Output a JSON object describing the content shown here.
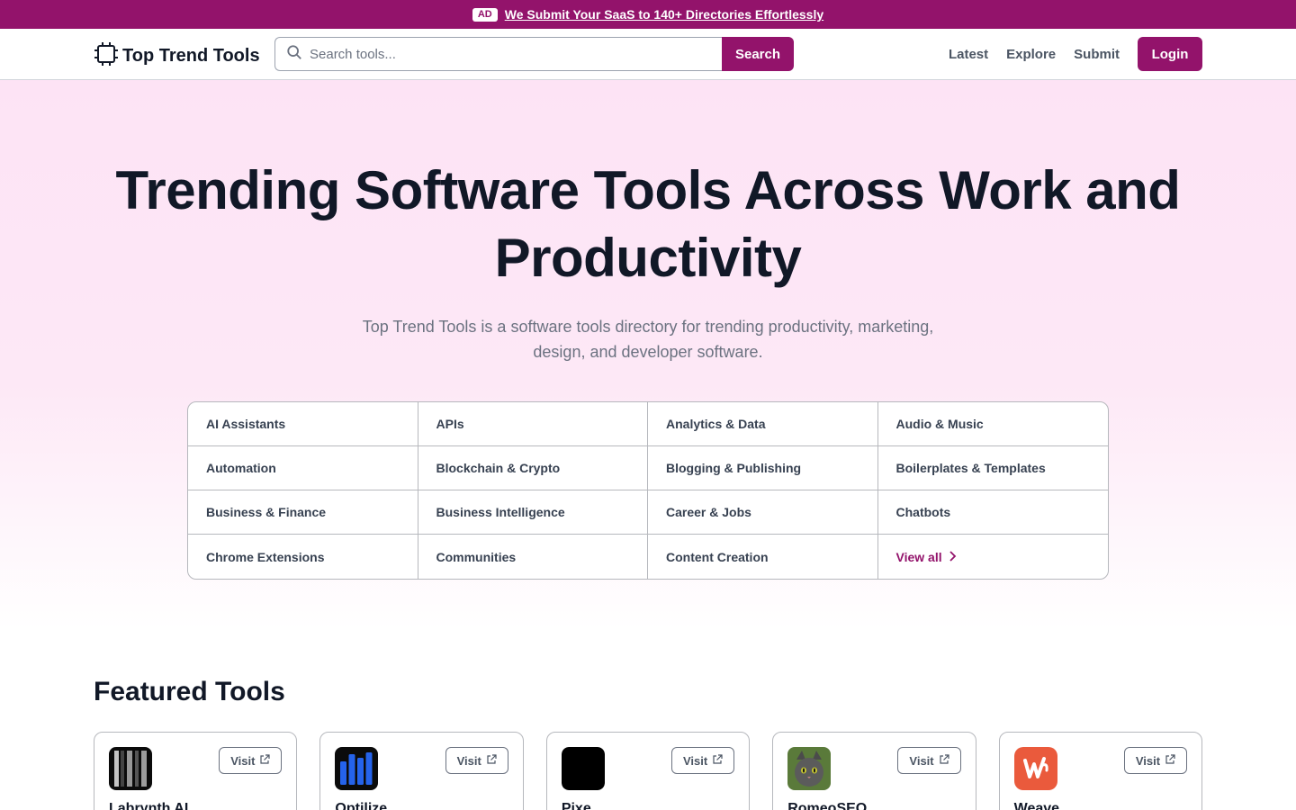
{
  "ad": {
    "badge": "AD",
    "text": "We Submit Your SaaS to 140+ Directories Effortlessly"
  },
  "header": {
    "logo_text": "Top Trend Tools",
    "search_placeholder": "Search tools...",
    "search_button": "Search",
    "nav": [
      "Latest",
      "Explore",
      "Submit"
    ],
    "login": "Login"
  },
  "hero": {
    "title": "Trending Software Tools Across Work and Productivity",
    "subtitle": "Top Trend Tools is a software tools directory for trending productivity, marketing, design, and developer software."
  },
  "categories": [
    "AI Assistants",
    "APIs",
    "Analytics & Data",
    "Audio & Music",
    "Automation",
    "Blockchain & Crypto",
    "Blogging & Publishing",
    "Boilerplates & Templates",
    "Business & Finance",
    "Business Intelligence",
    "Career & Jobs",
    "Chatbots",
    "Chrome Extensions",
    "Communities",
    "Content Creation"
  ],
  "view_all": "View all",
  "featured": {
    "title": "Featured Tools",
    "visit_label": "Visit",
    "tools": [
      {
        "name": "Labrynth AI",
        "icon": "labrynth-logo-icon",
        "color": "#111111"
      },
      {
        "name": "Optilize",
        "icon": "optilize-bars-logo-icon",
        "color": "#1d4ed8"
      },
      {
        "name": "Pixe",
        "icon": "pixe-logo-icon",
        "color": "#000000"
      },
      {
        "name": "RomeoSEO",
        "icon": "cat-logo-icon",
        "color": "#5a7a3a"
      },
      {
        "name": "Weave",
        "icon": "weave-w-logo-icon",
        "color": "#ea5a3c"
      }
    ]
  },
  "colors": {
    "brand": "#93136b"
  }
}
